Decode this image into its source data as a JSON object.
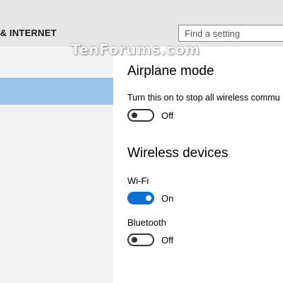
{
  "header": {
    "section_title": "& INTERNET",
    "search_placeholder": "Find a setting"
  },
  "watermark": "TenForums.com",
  "airplane": {
    "heading": "Airplane mode",
    "description": "Turn this on to stop all wireless commu",
    "state_label": "Off",
    "enabled": false
  },
  "wireless": {
    "heading": "Wireless devices",
    "wifi": {
      "label": "Wi-Fi",
      "state_label": "On",
      "enabled": true
    },
    "bluetooth": {
      "label": "Bluetooth",
      "state_label": "Off",
      "enabled": false
    }
  },
  "colors": {
    "accent": "#0b6fd6",
    "sidebar_selected": "#99c5ea",
    "header_bg": "#e6e6e6"
  }
}
